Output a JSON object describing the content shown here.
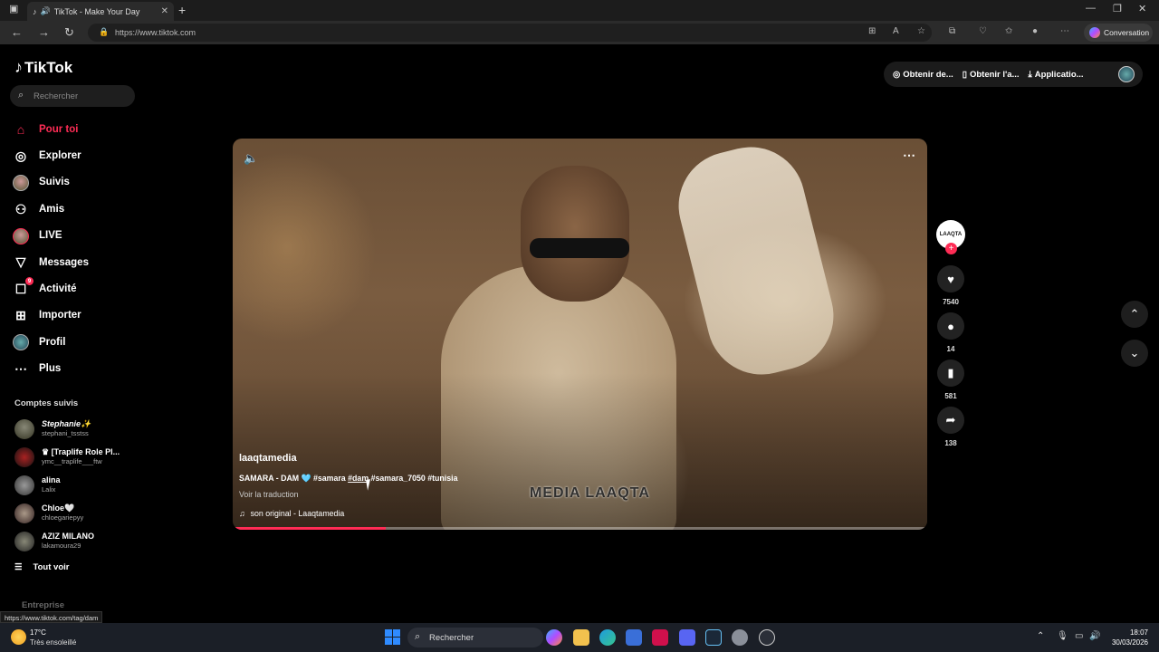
{
  "browser": {
    "tab_title": "TikTok - Make Your Day",
    "url": "https://www.tiktok.com",
    "copilot_label": "Conversation"
  },
  "tiktok": {
    "logo_text": "TikTok",
    "search_placeholder": "Rechercher",
    "nav": [
      {
        "label": "Pour toi",
        "icon": "home-icon"
      },
      {
        "label": "Explorer",
        "icon": "compass-icon"
      },
      {
        "label": "Suivis",
        "icon": "avatar"
      },
      {
        "label": "Amis",
        "icon": "friends-icon"
      },
      {
        "label": "LIVE",
        "icon": "live-avatar"
      },
      {
        "label": "Messages",
        "icon": "send-icon"
      },
      {
        "label": "Activité",
        "icon": "activity-icon",
        "badge": "9"
      },
      {
        "label": "Importer",
        "icon": "plus-square-icon"
      },
      {
        "label": "Profil",
        "icon": "profile-avatar"
      },
      {
        "label": "Plus",
        "icon": "more-icon"
      }
    ],
    "followed_title": "Comptes suivis",
    "followed": [
      {
        "name": "Stephanie✨",
        "user": "stephani_tsstss"
      },
      {
        "name": "♛ [Traplife Role Pl...",
        "user": "ymc__traplife___ftw"
      },
      {
        "name": "alina",
        "user": "Lalix"
      },
      {
        "name": "Chloe🤍",
        "user": "chloegariepyy"
      },
      {
        "name": "AZIZ MILANO",
        "user": "lakamoura29"
      }
    ],
    "see_all": "Tout voir",
    "entreprise": "Entreprise",
    "status_url": "https://www.tiktok.com/tag/dam",
    "top_actions": [
      "Obtenir de...",
      "Obtenir l'a...",
      "Applicatio..."
    ],
    "video": {
      "author": "laaqtamedia",
      "desc_prefix": "SAMARA - DAM 🩵",
      "tags": [
        "#samara",
        "#dam",
        "#samara_7050",
        "#tunisia"
      ],
      "translate": "Voir la traduction",
      "music": "son original - Laaqtamedia",
      "watermark": "MEDIA LAAQTA",
      "progress": 0.22
    },
    "stats": {
      "avatar_text": "LAAQTA",
      "likes": "7540",
      "comments": "14",
      "saves": "581",
      "shares": "138"
    }
  },
  "taskbar": {
    "temp": "17°C",
    "weather": "Très ensoleillé",
    "search": "Rechercher",
    "time": "18:07",
    "date": "30/03/2026"
  },
  "colors": {
    "accent": "#fe2c55",
    "background": "#000000"
  }
}
